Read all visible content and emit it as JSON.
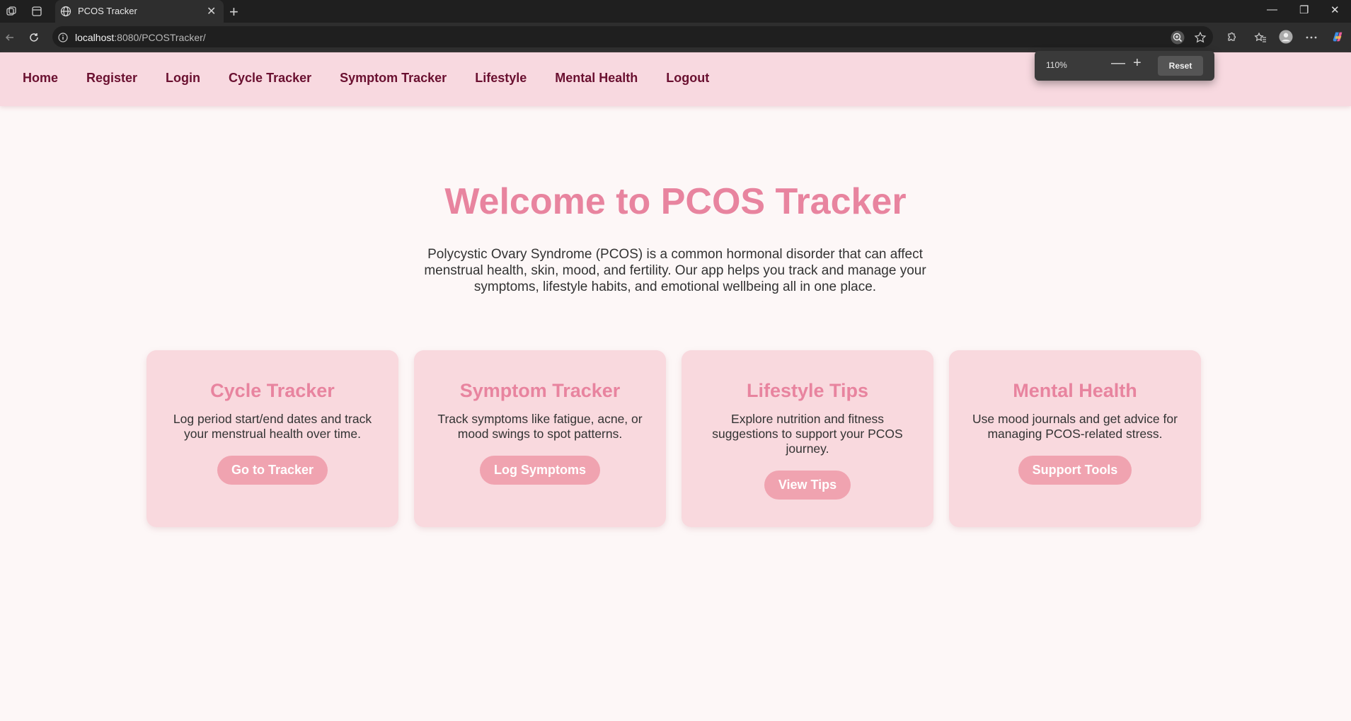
{
  "browser": {
    "tab_title": "PCOS Tracker",
    "url_host": "localhost",
    "url_path": ":8080/PCOSTracker/",
    "zoom": {
      "level": "110%",
      "reset_label": "Reset"
    }
  },
  "nav": {
    "items": [
      "Home",
      "Register",
      "Login",
      "Cycle Tracker",
      "Symptom Tracker",
      "Lifestyle",
      "Mental Health",
      "Logout"
    ]
  },
  "hero": {
    "title": "Welcome to PCOS Tracker",
    "text": "Polycystic Ovary Syndrome (PCOS) is a common hormonal disorder that can affect menstrual health, skin, mood, and fertility. Our app helps you track and manage your symptoms, lifestyle habits, and emotional wellbeing all in one place."
  },
  "cards": [
    {
      "title": "Cycle Tracker",
      "desc": "Log period start/end dates and track your menstrual health over time.",
      "button": "Go to Tracker"
    },
    {
      "title": "Symptom Tracker",
      "desc": "Track symptoms like fatigue, acne, or mood swings to spot patterns.",
      "button": "Log Symptoms"
    },
    {
      "title": "Lifestyle Tips",
      "desc": "Explore nutrition and fitness suggestions to support your PCOS journey.",
      "button": "View Tips"
    },
    {
      "title": "Mental Health",
      "desc": "Use mood journals and get advice for managing PCOS-related stress.",
      "button": "Support Tools"
    }
  ],
  "colors": {
    "accent": "#e8849f",
    "nav_bg": "#f8d9e0",
    "nav_text": "#6a1030",
    "card_bg": "#f9d9de",
    "button_bg": "#f0a3b0",
    "page_bg": "#fdf7f7"
  }
}
